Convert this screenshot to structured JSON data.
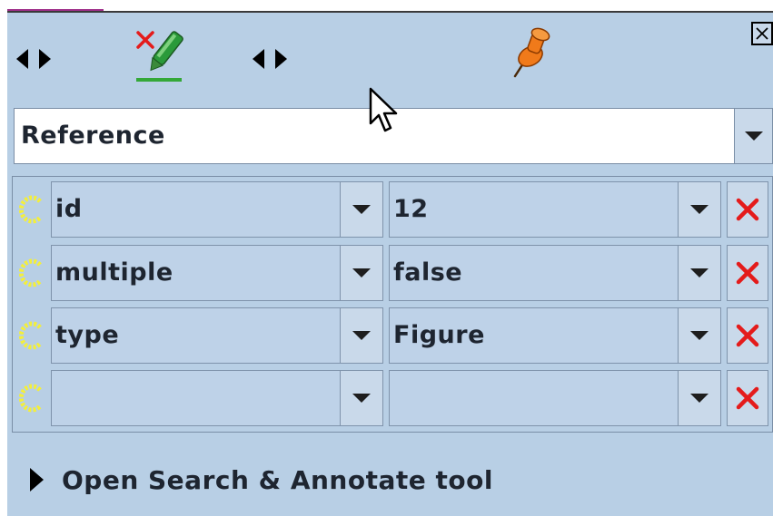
{
  "toolbar": {
    "left_nav": {
      "prev_icon": "triangle-left-icon",
      "next_icon": "triangle-right-icon"
    },
    "tool_icon": "remove-highlighter-icon",
    "right_nav": {
      "prev_icon": "triangle-left-icon",
      "next_icon": "triangle-right-icon"
    },
    "pin_icon": "pushpin-icon",
    "close_icon": "close-icon"
  },
  "annotation_type": {
    "value": "Reference"
  },
  "features": [
    {
      "name": "id",
      "value": "12"
    },
    {
      "name": "multiple",
      "value": "false"
    },
    {
      "name": "type",
      "value": "Figure"
    },
    {
      "name": "",
      "value": ""
    }
  ],
  "footer": {
    "link_label": "Open Search & Annotate tool"
  },
  "colors": {
    "panel_bg": "#b8cfe5",
    "field_bg": "#bed2e8",
    "delete_red": "#e41b1b",
    "c_icon": "#f4ef3a",
    "pin": "#f07a1a",
    "marker": "#2a9a3a"
  }
}
